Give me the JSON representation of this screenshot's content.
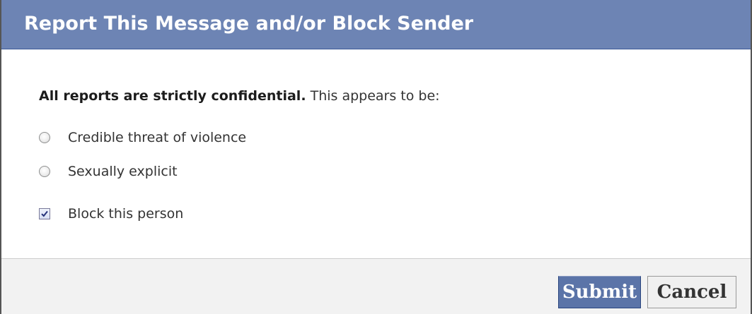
{
  "dialog": {
    "title": "Report This Message and/or Block Sender",
    "intro_bold": "All reports are strictly confidential.",
    "intro_rest": " This appears to be:",
    "options": [
      {
        "label": "Credible threat of violence",
        "type": "radio",
        "checked": false
      },
      {
        "label": "Sexually explicit",
        "type": "radio",
        "checked": false
      }
    ],
    "block": {
      "label": "Block this person",
      "type": "checkbox",
      "checked": true
    },
    "buttons": {
      "submit_label": "Submit",
      "cancel_label": "Cancel"
    }
  },
  "colors": {
    "titlebar": "#6d84b4",
    "submit_button": "#5b74a8",
    "footer": "#f2f2f2"
  }
}
